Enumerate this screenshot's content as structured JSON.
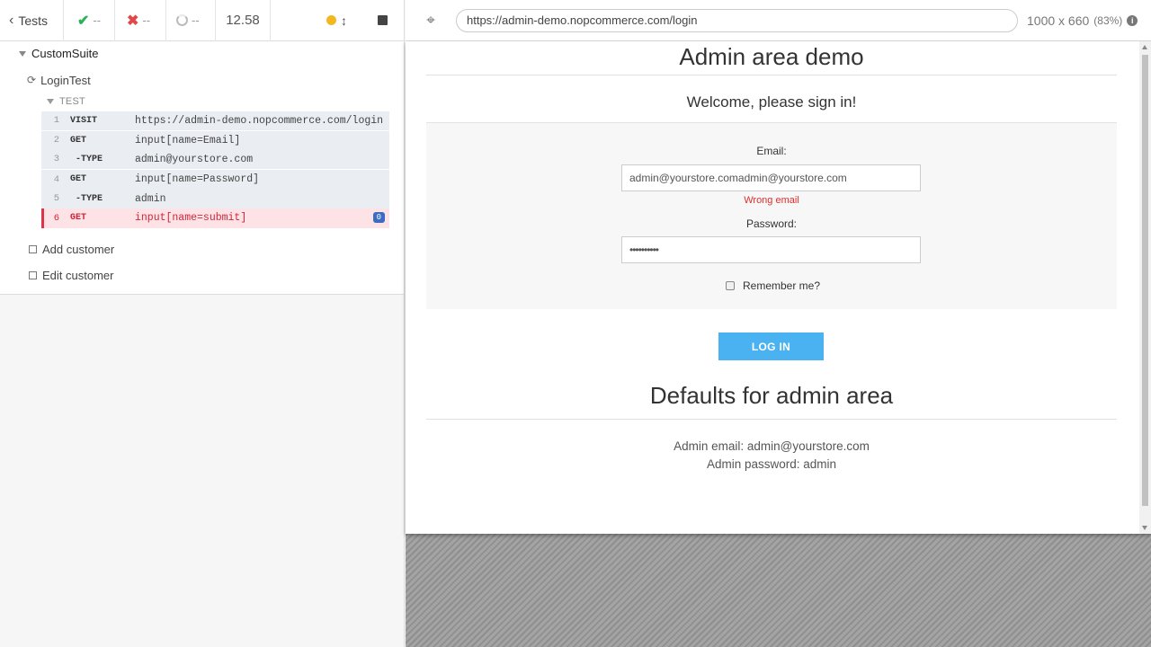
{
  "topbar": {
    "back_label": "Tests",
    "passed": "--",
    "failed": "--",
    "pending": "--",
    "duration": "12.58"
  },
  "reporter": {
    "suite_name": "CustomSuite",
    "test_name": "LoginTest",
    "hook_label": "TEST",
    "commands": [
      {
        "num": "1",
        "name": "VISIT",
        "message": "https://admin-demo.nopcommerce.com/login"
      },
      {
        "num": "2",
        "name": "GET",
        "message": "input[name=Email]"
      },
      {
        "num": "3",
        "name": "-TYPE",
        "message": "admin@yourstore.com"
      },
      {
        "num": "4",
        "name": "GET",
        "message": "input[name=Password]"
      },
      {
        "num": "5",
        "name": "-TYPE",
        "message": "admin"
      },
      {
        "num": "6",
        "name": "GET",
        "message": "input[name=submit]",
        "badge": "0"
      }
    ],
    "other_tests": [
      "Add customer",
      "Edit customer"
    ]
  },
  "browser": {
    "url": "https://admin-demo.nopcommerce.com/login",
    "viewport": "1000 x 660",
    "scale": "(83%)"
  },
  "aut": {
    "title": "Admin area demo",
    "welcome": "Welcome, please sign in!",
    "email_label": "Email:",
    "email_value": "admin@yourstore.comadmin@yourstore.com",
    "email_error": "Wrong email",
    "password_label": "Password:",
    "password_value": "••••••••••",
    "remember_label": "Remember me?",
    "login_button": "LOG IN",
    "defaults_title": "Defaults for admin area",
    "admin_email_line": "Admin email: admin@yourstore.com",
    "admin_password_line": "Admin password: admin"
  },
  "colors": {
    "pass": "#2bb35c",
    "fail": "#e24848",
    "running": "#f3b81f",
    "error_row": "#fde3e6",
    "button": "#4ab2f1"
  }
}
